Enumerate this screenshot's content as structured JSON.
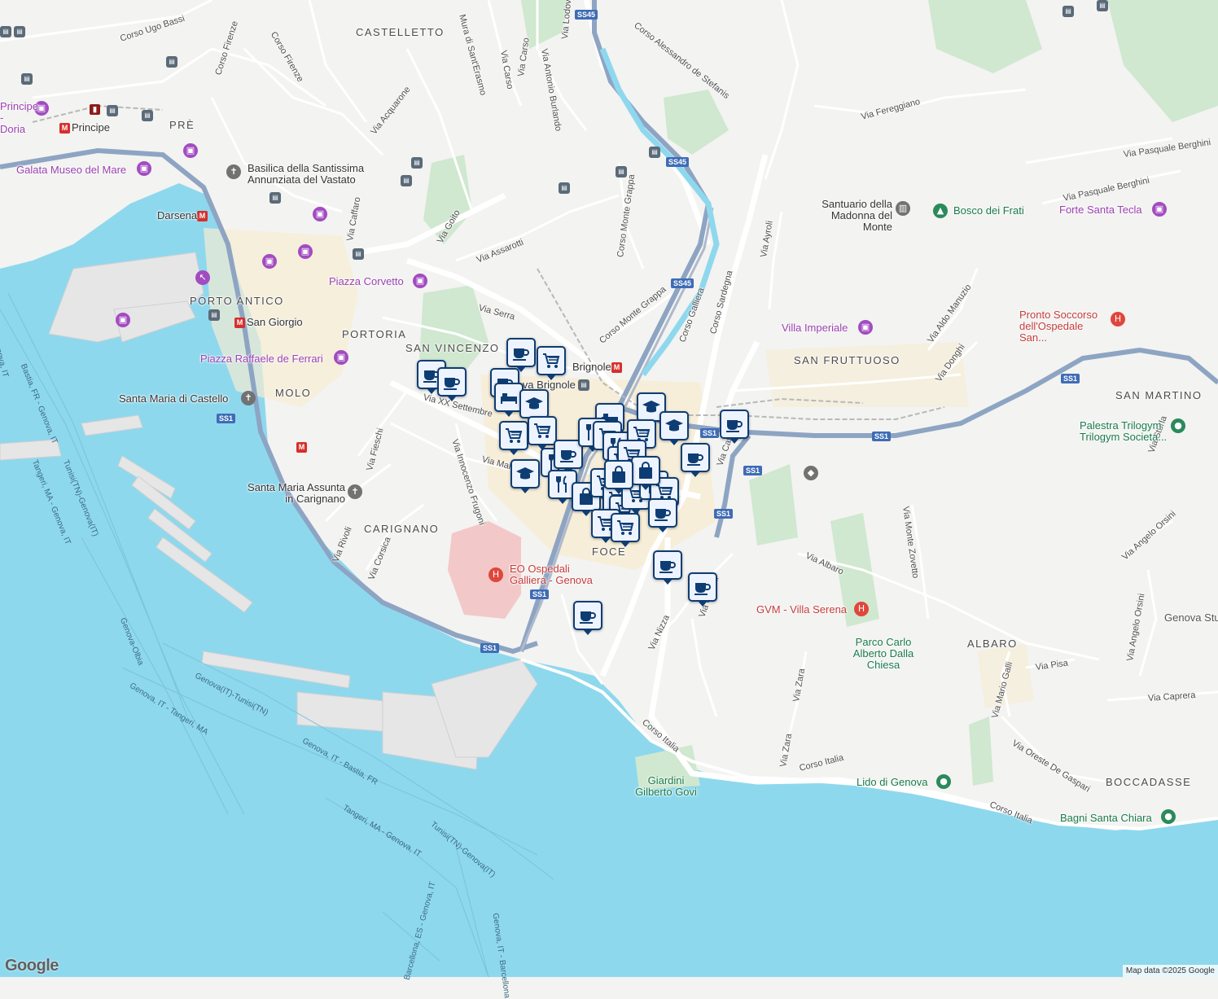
{
  "attribution": "Map data ©2025 Google",
  "logo": "Google",
  "districts": [
    "CASTELLETTO",
    "PRÈ",
    "PORTO ANTICO",
    "PORTORIA",
    "SAN VINCENZO",
    "MOLO",
    "CARIGNANO",
    "FOCE",
    "SAN FRUTTUOSO",
    "SAN MARTINO",
    "ALBARO",
    "BOCCADASSE"
  ],
  "streets": [
    "Corso Ugo Bassi",
    "Corso Firenze",
    "Corso Firenze",
    "Mura di Sant'Erasmo",
    "Via Carso",
    "Via Carso",
    "Via Antonio Burlando",
    "Via Lodovico",
    "Corso Alessandro de Stefanis",
    "Via Fereggiano",
    "Via Pasquale Berghini",
    "Via Pasquale Berghini",
    "Via Acquarone",
    "Via Goito",
    "Via Caffaro",
    "Via Assarotti",
    "Via Serra",
    "Corso Monte Grappa",
    "Corso Monte Grappa",
    "Corso Galliera",
    "Corso Sardegna",
    "Via Ayroli",
    "Via Aldo Manuzio",
    "Via Donghi",
    "Via XX Settembre",
    "Via Fieschi",
    "Via Innocenzo Frugoni",
    "Via Malta",
    "Via Rivoli",
    "Via Corsica",
    "Via Albaro",
    "Via Monte Zovetto",
    "Via Angelo Orsini",
    "Via Sturla",
    "Via Nizza",
    "Via Cecchi",
    "Via Zara",
    "Via Zara",
    "Via Mario Galli",
    "Via Pisa",
    "Via Oreste De Gaspari",
    "Via Caprera",
    "Corso Italia",
    "Corso Italia",
    "Corso Italia",
    "Via Angelo Orsini",
    "Via Cafe"
  ],
  "pois": {
    "principe_doria": "Principe - Doria",
    "principe": "Principe",
    "galata": "Galata Museo del Mare",
    "basilica": "Basilica della Santissima Annunziata del Vastato",
    "darsena": "Darsena",
    "piazza_corvetto": "Piazza Corvetto",
    "san_giorgio": "San Giorgio",
    "ferrari": "Piazza Raffaele de Ferrari",
    "santa_maria_castello": "Santa Maria di Castello",
    "santa_maria_assunta": "Santa Maria Assunta in Carignano",
    "ospedale_galliera": "EO Ospedali Galliera - Genova",
    "brignole": "Brignole",
    "brignole_station": "Genova Brignole",
    "santuario": "Santuario della Madonna del Monte",
    "bosco_frati": "Bosco dei Frati",
    "forte_tecla": "Forte Santa Tecla",
    "villa_imperiale": "Villa Imperiale",
    "pronto_soccorso": "Pronto Soccorso dell'Ospedale San...",
    "palestra": "Palestra Trilogym Trilogym Societa...",
    "gvm": "GVM - Villa Serena",
    "parco": "Parco Carlo Alberto Dalla Chiesa",
    "lido": "Lido di Genova",
    "bagni": "Bagni Santa Chiara",
    "giardini": "Giardini Gilberto Govi",
    "genova_stu": "Genova Stu"
  },
  "roads": [
    "SS45",
    "SS45",
    "SS45",
    "SS1",
    "SS1",
    "SS1",
    "SS1",
    "SS1",
    "SS1",
    "SS1",
    "SS1"
  ],
  "sea_routes": [
    "Bastia, FR - Genova, IT",
    "Tunisi(TN)-Genova(IT)",
    "Genova, IT",
    "Tangeri, MA - Genova, IT",
    "Genova-Olbia",
    "Genova(IT)-Tunisi(TN)",
    "Genova, IT - Tangeri, MA",
    "Genova, IT - Bastia, FR",
    "Tangeri, MA - Genova, IT",
    "Tunisi(TN)-Genova(IT)",
    "Bastia, FR",
    "Barcellona, ES - Genova, IT",
    "Genova, IT - Barcellona"
  ],
  "marker_icons": [
    "coffee-icon",
    "shopping-cart-icon",
    "restaurant-icon",
    "school-icon",
    "shopping-bag-icon",
    "bed-icon"
  ]
}
